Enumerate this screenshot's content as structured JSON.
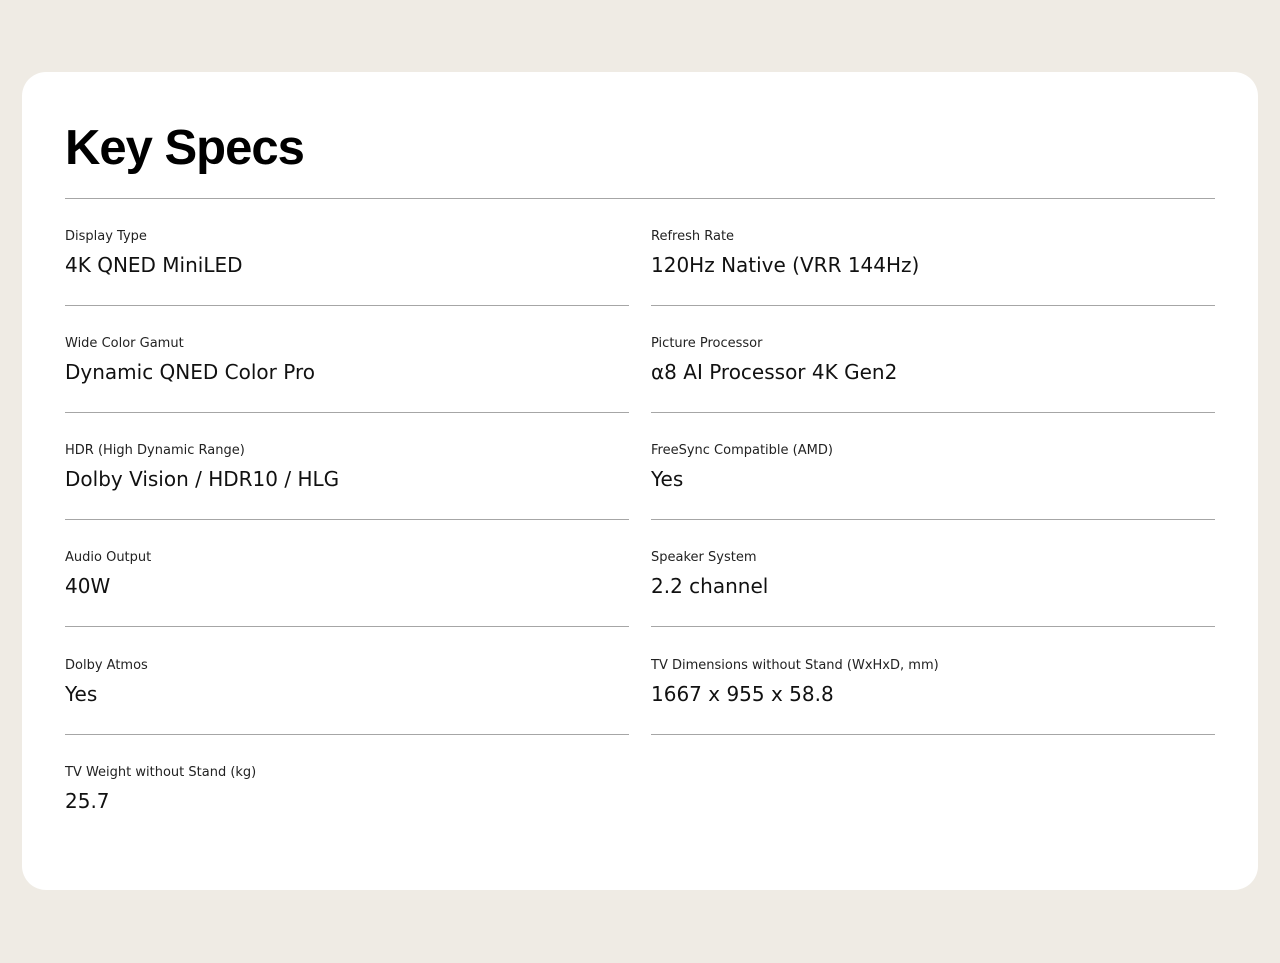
{
  "title": "Key Specs",
  "specs": [
    {
      "label": "Display Type",
      "value": "4K QNED MiniLED"
    },
    {
      "label": "Refresh Rate",
      "value": "120Hz Native (VRR 144Hz)"
    },
    {
      "label": "Wide Color Gamut",
      "value": "Dynamic QNED Color Pro"
    },
    {
      "label": "Picture Processor",
      "value": "α8 AI Processor 4K Gen2"
    },
    {
      "label": "HDR (High Dynamic Range)",
      "value": "Dolby Vision / HDR10 / HLG"
    },
    {
      "label": "FreeSync Compatible (AMD)",
      "value": "Yes"
    },
    {
      "label": "Audio Output",
      "value": "40W"
    },
    {
      "label": "Speaker System",
      "value": "2.2 channel"
    },
    {
      "label": "Dolby Atmos",
      "value": "Yes"
    },
    {
      "label": "TV Dimensions without Stand (WxHxD, mm)",
      "value": "1667 x 955 x 58.8"
    },
    {
      "label": "TV Weight without Stand (kg)",
      "value": "25.7"
    }
  ]
}
